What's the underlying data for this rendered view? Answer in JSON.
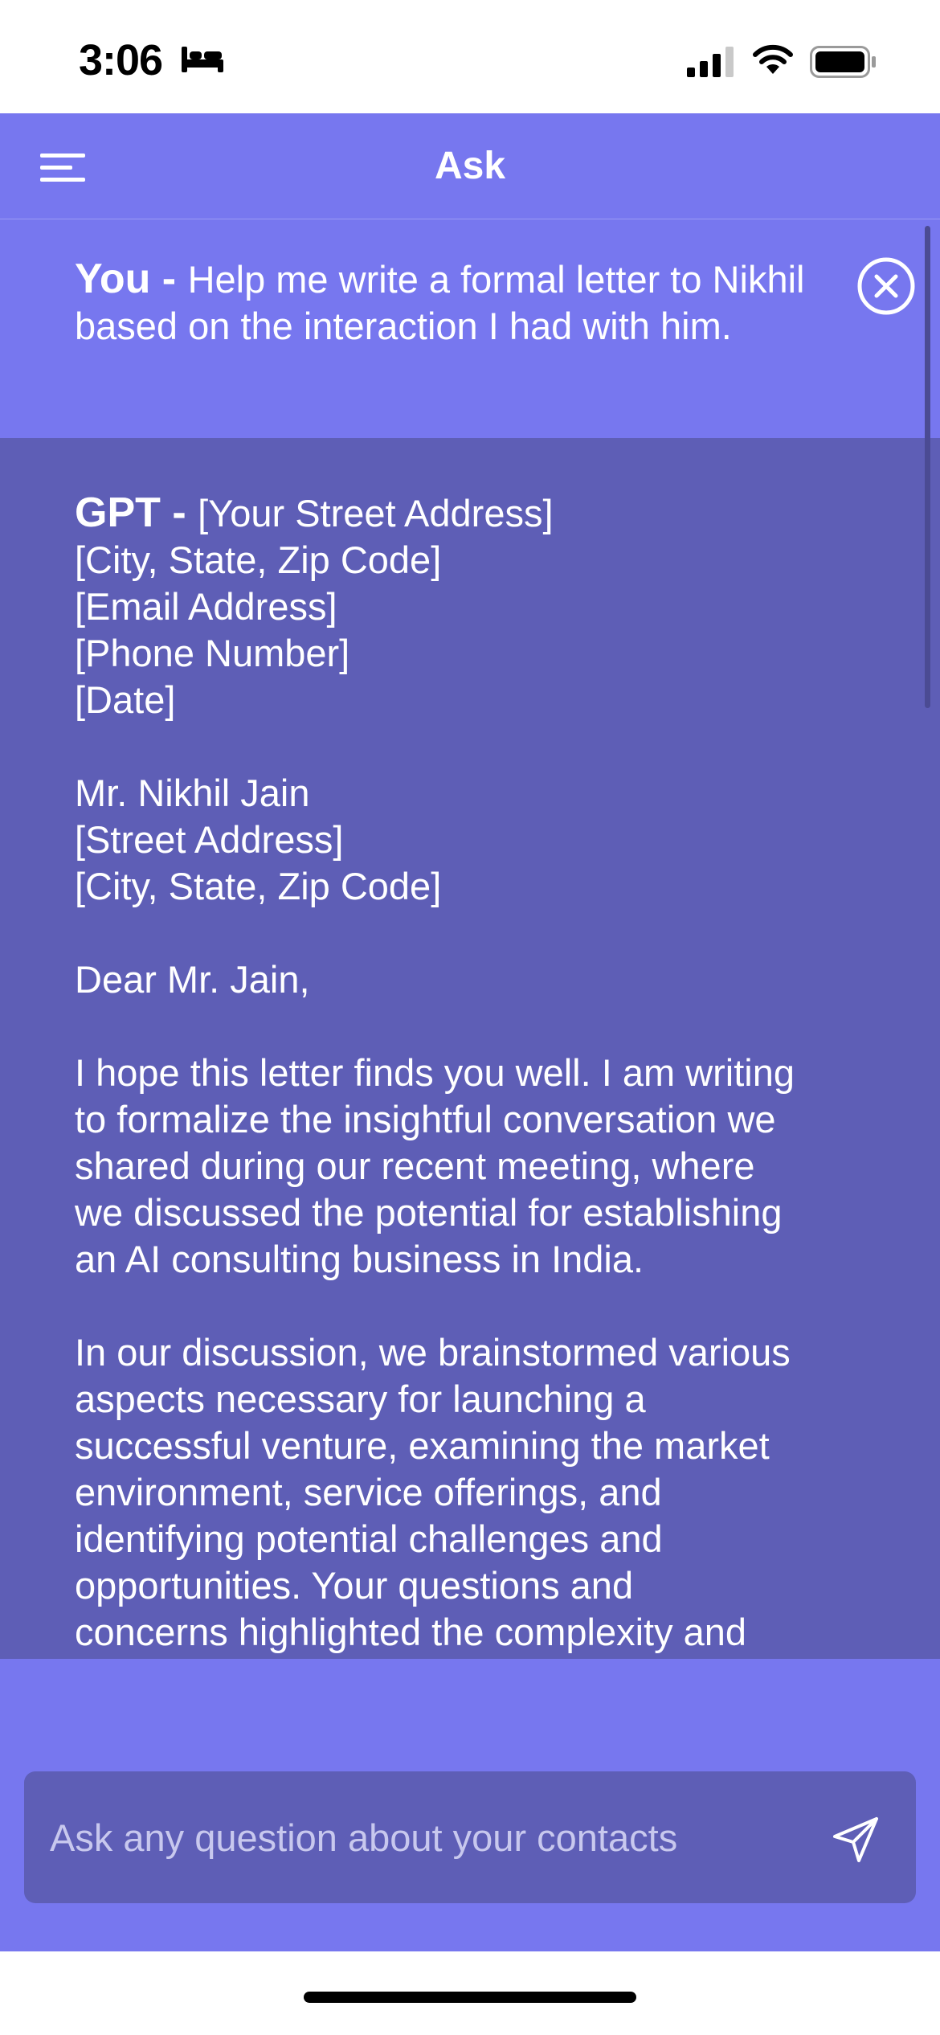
{
  "status_bar": {
    "time": "3:06",
    "icons": [
      "bed-icon",
      "signal-icon",
      "wifi-icon",
      "battery-icon"
    ]
  },
  "nav": {
    "title": "Ask",
    "menu_icon": "menu-icon"
  },
  "conversation": {
    "user": {
      "label": "You - ",
      "message": "Help me write a formal letter to Nikhil based on the interaction I had with him."
    },
    "close_icon": "close-icon",
    "gpt": {
      "label": "GPT - ",
      "first_line": "[Your Street Address]",
      "lines": [
        "[City, State, Zip Code]",
        "[Email Address]",
        "[Phone Number]",
        "[Date]",
        "",
        "Mr. Nikhil Jain",
        "[Street Address]",
        "[City, State, Zip Code]",
        "",
        "Dear Mr. Jain,",
        "",
        "I hope this letter finds you well. I am writing",
        "to formalize the insightful conversation we",
        "shared during our recent meeting, where",
        "we discussed the potential for establishing",
        "an AI consulting business in India.",
        "",
        "In our discussion, we brainstormed various",
        "aspects necessary for launching a",
        "successful venture, examining the market",
        "environment, service offerings, and",
        "identifying potential challenges and",
        "opportunities. Your questions and",
        "concerns highlighted the complexity and"
      ]
    }
  },
  "composer": {
    "placeholder": "Ask any question about your contacts",
    "send_icon": "send-icon"
  },
  "colors": {
    "accent": "#7777ef",
    "response_bg": "#5e5eb6",
    "text": "#ffffff"
  }
}
